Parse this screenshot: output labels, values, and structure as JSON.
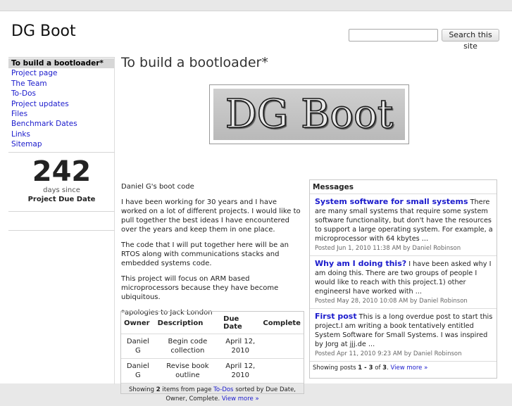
{
  "site_title": "DG Boot",
  "search": {
    "placeholder": "",
    "button": "Search this site"
  },
  "sidebar": {
    "items": [
      {
        "label": "To build a bootloader*",
        "active": true
      },
      {
        "label": "Project page"
      },
      {
        "label": "The Team"
      },
      {
        "label": "To-Dos"
      },
      {
        "label": "Project updates"
      },
      {
        "label": "Files"
      },
      {
        "label": "Benchmark Dates"
      },
      {
        "label": "Links"
      },
      {
        "label": "Sitemap"
      }
    ],
    "counter": {
      "value": "242",
      "unit": "days since",
      "label": "Project Due Date"
    }
  },
  "main": {
    "heading": "To build a bootloader*",
    "logo_text": "DG Boot",
    "paragraphs": [
      "Daniel G's boot code",
      "I have been working for 30 years and I have worked on a lot of different projects.  I would like to pull together the best ideas I have encountered over the years and keep them in one place.",
      "The code that I will put together here will be an RTOS along with communications stacks and embedded systems code.",
      "This project will focus on ARM based microprocessors because they have become ubiquitous.",
      "*apologies to Jack London"
    ]
  },
  "todo_table": {
    "headers": [
      "Owner",
      "Description",
      "Due Date",
      "Complete"
    ],
    "rows": [
      [
        "Daniel G",
        "Begin code collection",
        "April 12, 2010",
        ""
      ],
      [
        "Daniel G",
        "Revise book outline",
        "April 12, 2010",
        ""
      ]
    ],
    "footer": {
      "prefix": "Showing ",
      "count": "2",
      "middle": " items from page ",
      "page_link": "To-Dos",
      "suffix": " sorted by Due Date, Owner, Complete. ",
      "more": "View more »"
    }
  },
  "messages": {
    "title": "Messages",
    "posts": [
      {
        "title": "System software for small systems",
        "snippet": " There are many small systems that require some system software functionality, but don't have the resources to support a large operating system.  For example, a microprocessor with 64 kbytes ...",
        "meta": "Posted Jun 1, 2010 11:38 AM by Daniel Robinson"
      },
      {
        "title": "Why am I doing this?",
        "snippet": " I have been asked why I am doing this.  There are two groups of people I would like to reach with this project.1) other engineersI have worked with ...",
        "meta": "Posted May 28, 2010 10:08 AM by Daniel Robinson"
      },
      {
        "title": "First post",
        "snippet": " This is a long overdue post to start this project.I am writing a book tentatively entitled System Software for Small Systems.  I was inspired by Jorg at jjj.de ...",
        "meta": "Posted Apr 11, 2010 9:23 AM by Daniel Robinson"
      }
    ],
    "footer": {
      "prefix": "Showing posts ",
      "range": "1 - 3",
      "of": " of ",
      "total": "3",
      "more": "View more »"
    }
  }
}
